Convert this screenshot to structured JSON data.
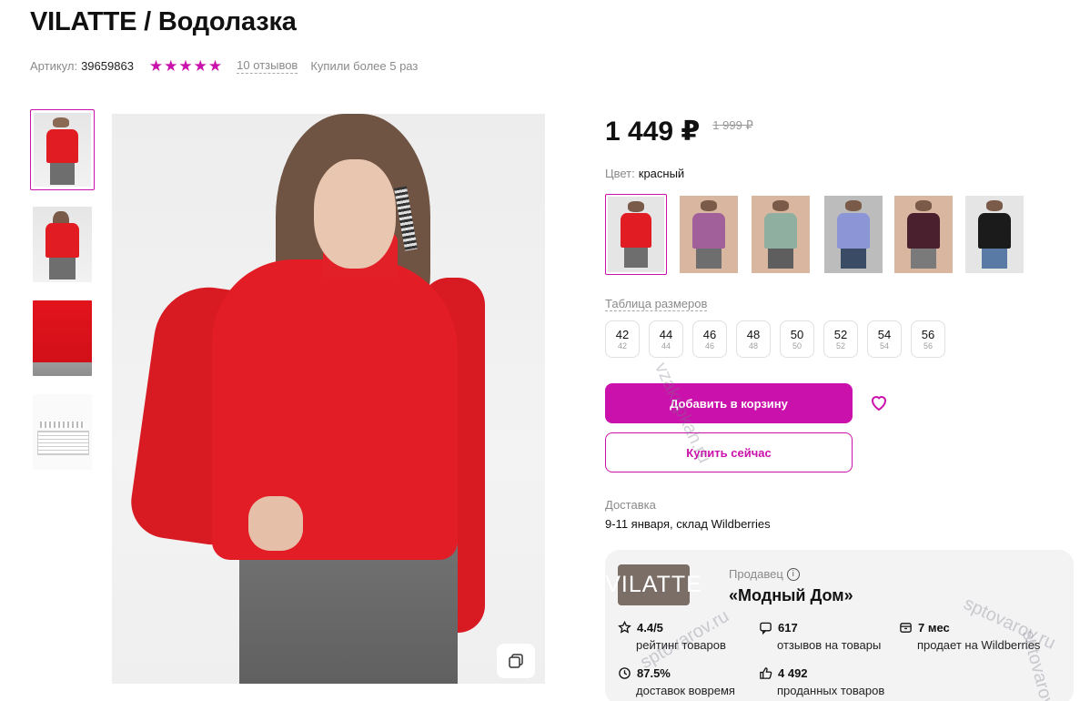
{
  "product": {
    "title": "VILATTE / Водолазка",
    "sku_label": "Артикул:",
    "sku_value": "39659863",
    "rating_stars": 5,
    "reviews_link": "10 отзывов",
    "bought_text": "Купили более 5 раз"
  },
  "gallery": {
    "thumbnails": [
      "model-front",
      "model-back",
      "fabric-closeup",
      "size-table"
    ],
    "active_index": 0
  },
  "pricing": {
    "current": "1 449 ₽",
    "old": "1 999 ₽"
  },
  "color": {
    "label": "Цвет:",
    "value": "красный",
    "swatches": [
      {
        "name": "red",
        "color": "#e11c22",
        "pants": "#6e6e6e",
        "bg": "#e5e5e5"
      },
      {
        "name": "lilac",
        "color": "#a2609a",
        "pants": "#6e6e6e",
        "bg": "#d9b69f"
      },
      {
        "name": "mint",
        "color": "#8fb0a0",
        "pants": "#5e5e5e",
        "bg": "#d9b69f"
      },
      {
        "name": "lavender",
        "color": "#8c95d6",
        "pants": "#3a4b66",
        "bg": "#bcbcbc"
      },
      {
        "name": "plum",
        "color": "#4a1f2e",
        "pants": "#7a7a7a",
        "bg": "#d9b69f"
      },
      {
        "name": "black",
        "color": "#1b1b1b",
        "pants": "#5a7aa6",
        "bg": "#e5e5e5"
      }
    ]
  },
  "sizes": {
    "table_link": "Таблица размеров",
    "items": [
      {
        "size": "42",
        "sub": "42"
      },
      {
        "size": "44",
        "sub": "44"
      },
      {
        "size": "46",
        "sub": "46"
      },
      {
        "size": "48",
        "sub": "48"
      },
      {
        "size": "50",
        "sub": "50"
      },
      {
        "size": "52",
        "sub": "52"
      },
      {
        "size": "54",
        "sub": "54"
      },
      {
        "size": "56",
        "sub": "56"
      }
    ]
  },
  "actions": {
    "add_to_cart": "Добавить в корзину",
    "buy_now": "Купить сейчас"
  },
  "delivery": {
    "label": "Доставка",
    "value": "9-11 января, склад Wildberries"
  },
  "seller": {
    "logo_text": "VILATTE",
    "label": "Продавец",
    "name": "«Модный Дом»",
    "stats": [
      {
        "icon": "star-outline-icon",
        "value": "4.4/5",
        "caption": "рейтинг товаров"
      },
      {
        "icon": "chat-icon",
        "value": "617",
        "caption": "отзывов на товары"
      },
      {
        "icon": "box-icon",
        "value": "7 мес",
        "caption": "продает на Wildberries"
      },
      {
        "icon": "clock-icon",
        "value": "87.5%",
        "caption": "доставок вовремя"
      },
      {
        "icon": "thumbs-up-icon",
        "value": "4 492",
        "caption": "проданных товаров"
      }
    ]
  },
  "colors": {
    "accent": "#cb11ab",
    "text_muted": "#8a8a8a",
    "card_bg": "#f3f3f3"
  },
  "watermarks": [
    "vzakupkah.ru",
    "sptovarov.ru",
    "sptovarov.ru",
    "sptovarov.ru"
  ]
}
